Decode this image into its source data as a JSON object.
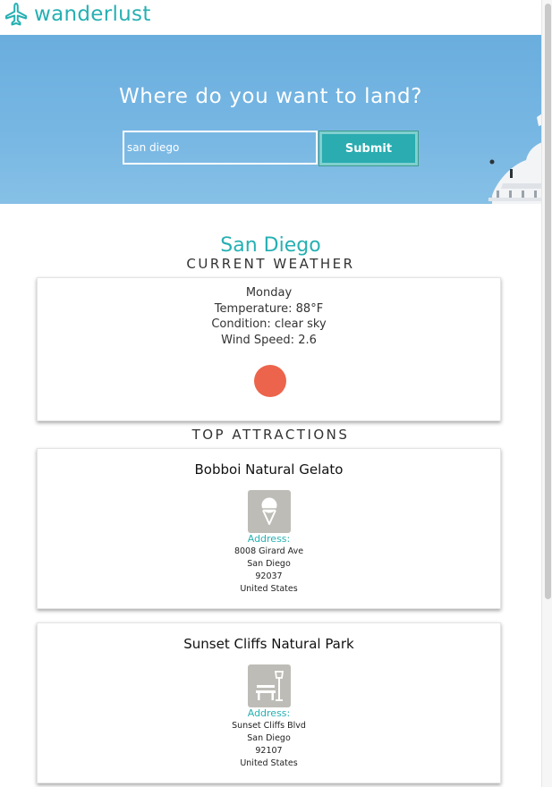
{
  "brand": {
    "name": "wanderlust",
    "accent_color": "#26b0b3",
    "logo_icon": "airplane-icon"
  },
  "hero": {
    "title": "Where do you want to land?"
  },
  "search": {
    "value": "san diego",
    "submit_label": "Submit"
  },
  "city": {
    "name": "San Diego"
  },
  "weather": {
    "heading": "CURRENT WEATHER",
    "day": "Monday",
    "temperature": "Temperature: 88°F",
    "condition": "Condition: clear sky",
    "wind": "Wind Speed: 2.6",
    "icon": "sun-icon",
    "icon_color": "#ec644b"
  },
  "attractions": {
    "heading": "TOP ATTRACTIONS",
    "items": [
      {
        "name": "Bobboi Natural Gelato",
        "icon": "ice-cream-icon",
        "address_label": "Address:",
        "street": "8008 Girard Ave",
        "city": "San Diego",
        "zip": "92037",
        "country": "United States"
      },
      {
        "name": "Sunset Cliffs Natural Park",
        "icon": "park-bench-icon",
        "address_label": "Address:",
        "street": "Sunset Cliffs Blvd",
        "city": "San Diego",
        "zip": "92107",
        "country": "United States"
      }
    ]
  }
}
